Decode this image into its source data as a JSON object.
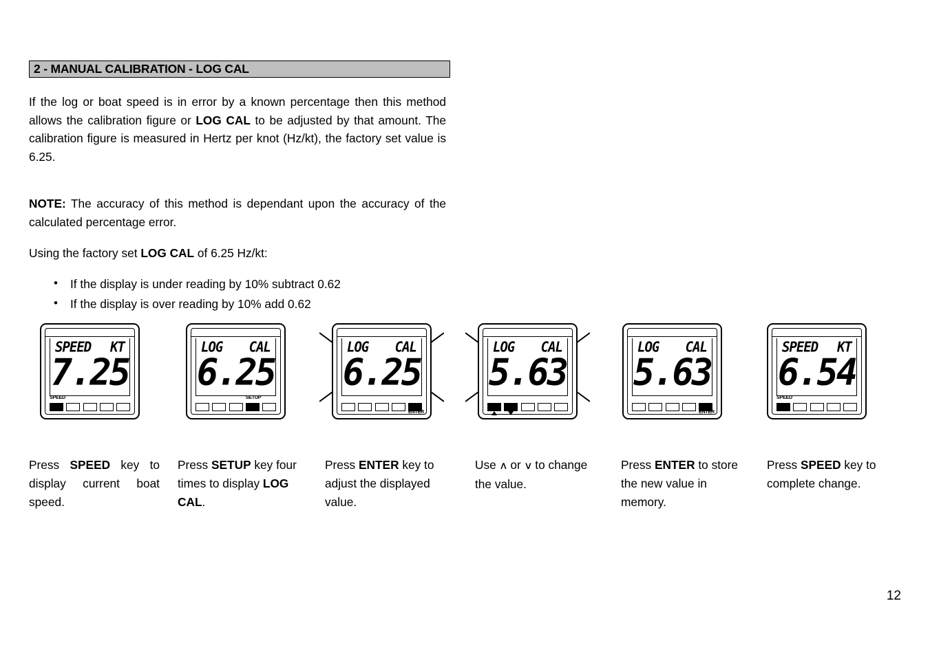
{
  "heading": {
    "text": "2 - MANUAL CALIBRATION - LOG CAL"
  },
  "paragraphs": {
    "intro_1": "If the log or boat speed is in error by a known percentage then this method allows the calibration figure or ",
    "intro_bold": "LOG CAL",
    "intro_2": " to be adjusted by that amount. The calibration figure is measured in Hertz per knot (Hz/kt), the factory set value is 6.25.",
    "note_label": "NOTE:",
    "note_text": " The accuracy of this method is dependant upon the accuracy of the calculated percentage error.",
    "using_1": "Using the factory set ",
    "using_bold": "LOG CAL",
    "using_2": " of 6.25 Hz/kt:"
  },
  "bullets": [
    "If the display is under reading by 10% subtract 0.62",
    "If the display is over reading by 10% add 0.62"
  ],
  "units": [
    {
      "id": "unit-1",
      "lcd_left": "SPEED",
      "lcd_right": "KT",
      "lcd_value": "7.25",
      "buttons": [
        true,
        false,
        false,
        false,
        false
      ],
      "label": "SPEED",
      "label_index": 0,
      "label_position": "above",
      "flashing": false,
      "arrows": false
    },
    {
      "id": "unit-2",
      "lcd_left": "LOG",
      "lcd_right": "CAL",
      "lcd_value": "6.25",
      "buttons": [
        false,
        false,
        false,
        true,
        false
      ],
      "label": "SETUP",
      "label_index": 3,
      "label_position": "above",
      "flashing": false,
      "arrows": false
    },
    {
      "id": "unit-3",
      "lcd_left": "LOG",
      "lcd_right": "CAL",
      "lcd_value": "6.25",
      "buttons": [
        false,
        false,
        false,
        false,
        true
      ],
      "label": "ENTER",
      "label_index": 4,
      "label_position": "below",
      "flashing": true,
      "arrows": false
    },
    {
      "id": "unit-4",
      "lcd_left": "LOG",
      "lcd_right": "CAL",
      "lcd_value": "5.63",
      "buttons": [
        true,
        true,
        false,
        false,
        false
      ],
      "label": "",
      "label_index": -1,
      "label_position": "below",
      "flashing": true,
      "arrows": true
    },
    {
      "id": "unit-5",
      "lcd_left": "LOG",
      "lcd_right": "CAL",
      "lcd_value": "5.63",
      "buttons": [
        false,
        false,
        false,
        false,
        true
      ],
      "label": "ENTER",
      "label_index": 4,
      "label_position": "below",
      "flashing": false,
      "arrows": false
    },
    {
      "id": "unit-6",
      "lcd_left": "SPEED",
      "lcd_right": "KT",
      "lcd_value": "6.54",
      "buttons": [
        true,
        false,
        false,
        false,
        false
      ],
      "label": "SPEED",
      "label_index": 0,
      "label_position": "above",
      "flashing": false,
      "arrows": false
    }
  ],
  "captions": [
    {
      "pre": "Press ",
      "bold": "SPEED",
      "post": " key to display current boat speed."
    },
    {
      "pre": "Press ",
      "bold": "SETUP",
      "post": " key four times to display ",
      "bold2": "LOG CAL",
      "post2": "."
    },
    {
      "pre": "Press ",
      "bold": "ENTER",
      "post": " key to adjust the displayed value."
    },
    {
      "pre": "Use ",
      "arrow_up": "∧",
      "mid": " or ",
      "arrow_down": "∨",
      "post": " to change the value."
    },
    {
      "pre": "Press ",
      "bold": "ENTER",
      "post": " to store the new value in memory."
    },
    {
      "pre": "Press ",
      "bold": "SPEED",
      "post": " key to complete change."
    }
  ],
  "page_number": "12",
  "colors": {
    "heading_bg": "#bfbfbf",
    "ink": "#000000",
    "paper": "#ffffff"
  }
}
